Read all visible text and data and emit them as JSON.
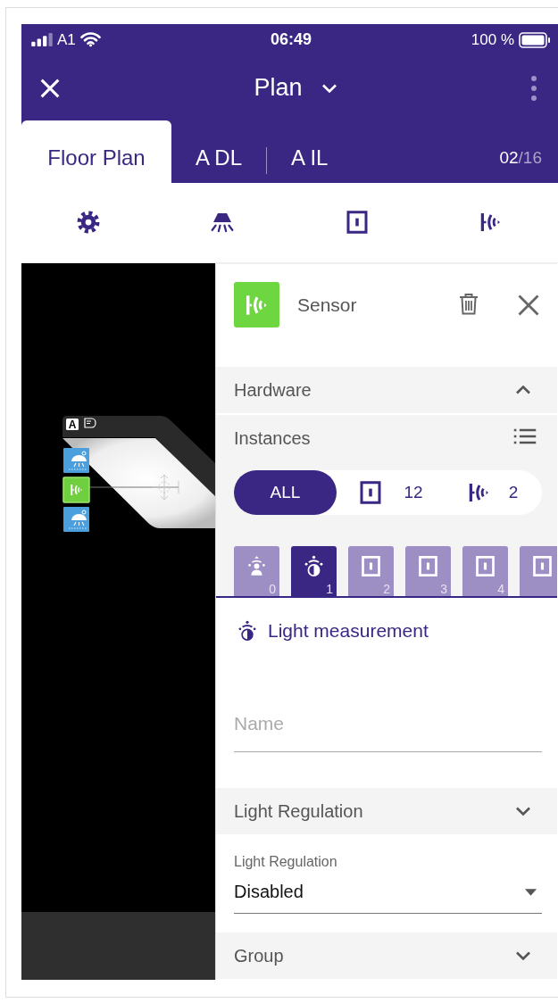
{
  "status_bar": {
    "carrier": "A1",
    "time": "06:49",
    "battery": "100 %"
  },
  "header": {
    "title": "Plan"
  },
  "tabs": [
    {
      "label": "Floor Plan",
      "selected": true
    },
    {
      "label": "A DL",
      "selected": false
    },
    {
      "label": "A IL",
      "selected": false
    }
  ],
  "page_counter": {
    "current": "02",
    "total": "/16"
  },
  "toolbar": [
    {
      "kind": "settings"
    },
    {
      "kind": "lamp"
    },
    {
      "kind": "switch"
    },
    {
      "kind": "sensor"
    }
  ],
  "canvas": {
    "badge": "A",
    "markers": [
      {
        "kind": "light"
      },
      {
        "kind": "sensor"
      },
      {
        "kind": "light"
      }
    ]
  },
  "panel": {
    "device": {
      "kind": "sensor",
      "title": "Sensor"
    },
    "hardware": {
      "title": "Hardware",
      "expanded": true,
      "instances_label": "Instances",
      "filters": [
        {
          "kind": "all",
          "label": "ALL",
          "selected": true
        },
        {
          "kind": "switch",
          "count": "12",
          "selected": false
        },
        {
          "kind": "sensor",
          "count": "2",
          "selected": false
        }
      ],
      "tiles": [
        {
          "kind": "presence",
          "number": "0",
          "selected": false
        },
        {
          "kind": "light",
          "number": "1",
          "selected": true
        },
        {
          "kind": "switch",
          "number": "2",
          "selected": false
        },
        {
          "kind": "switch",
          "number": "3",
          "selected": false
        },
        {
          "kind": "switch",
          "number": "4",
          "selected": false
        },
        {
          "kind": "switch",
          "selected": false
        }
      ]
    },
    "instance": {
      "kind": "light",
      "title": "Light measurement"
    },
    "name_field": {
      "placeholder": "Name"
    },
    "light_regulation": {
      "title": "Light Regulation",
      "expanded": false,
      "field": {
        "label": "Light Regulation",
        "value": "Disabled"
      }
    },
    "group": {
      "title": "Group",
      "expanded": false
    }
  }
}
